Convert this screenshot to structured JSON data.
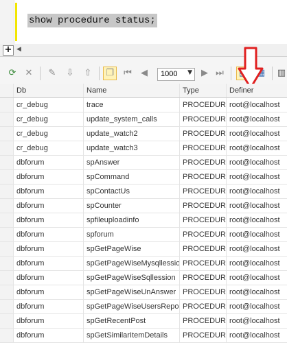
{
  "editor": {
    "query": "show procedure status;"
  },
  "split_bar": {
    "plus_symbol": "+"
  },
  "toolbar": {
    "limit_value": "1000",
    "accent_color": "#e8b94a",
    "icons": [
      "refresh-icon",
      "stop-icon",
      "edit-icon",
      "import-icon",
      "export-icon",
      "copy-icon",
      "first-page-icon",
      "prev-page-icon",
      "next-page-icon",
      "last-page-icon",
      "grid-view-icon",
      "form-view-icon",
      "text-view-icon"
    ]
  },
  "annotation": {
    "arrow_color": "#e02020"
  },
  "grid": {
    "columns": [
      "Db",
      "Name",
      "Type",
      "Definer"
    ],
    "rows": [
      [
        "cr_debug",
        "trace",
        "PROCEDURE",
        "root@localhost"
      ],
      [
        "cr_debug",
        "update_system_calls",
        "PROCEDURE",
        "root@localhost"
      ],
      [
        "cr_debug",
        "update_watch2",
        "PROCEDURE",
        "root@localhost"
      ],
      [
        "cr_debug",
        "update_watch3",
        "PROCEDURE",
        "root@localhost"
      ],
      [
        "dbforum",
        "spAnswer",
        "PROCEDURE",
        "root@localhost"
      ],
      [
        "dbforum",
        "spCommand",
        "PROCEDURE",
        "root@localhost"
      ],
      [
        "dbforum",
        "spContactUs",
        "PROCEDURE",
        "root@localhost"
      ],
      [
        "dbforum",
        "spCounter",
        "PROCEDURE",
        "root@localhost"
      ],
      [
        "dbforum",
        "spfileuploadinfo",
        "PROCEDURE",
        "root@localhost"
      ],
      [
        "dbforum",
        "spforum",
        "PROCEDURE",
        "root@localhost"
      ],
      [
        "dbforum",
        "spGetPageWise",
        "PROCEDURE",
        "root@localhost"
      ],
      [
        "dbforum",
        "spGetPageWiseMysqllession",
        "PROCEDURE",
        "root@localhost"
      ],
      [
        "dbforum",
        "spGetPageWiseSqllession",
        "PROCEDURE",
        "root@localhost"
      ],
      [
        "dbforum",
        "spGetPageWiseUnAnswer",
        "PROCEDURE",
        "root@localhost"
      ],
      [
        "dbforum",
        "spGetPageWiseUsersReport",
        "PROCEDURE",
        "root@localhost"
      ],
      [
        "dbforum",
        "spGetRecentPost",
        "PROCEDURE",
        "root@localhost"
      ],
      [
        "dbforum",
        "spGetSimilarItemDetails",
        "PROCEDURE",
        "root@localhost"
      ]
    ]
  }
}
